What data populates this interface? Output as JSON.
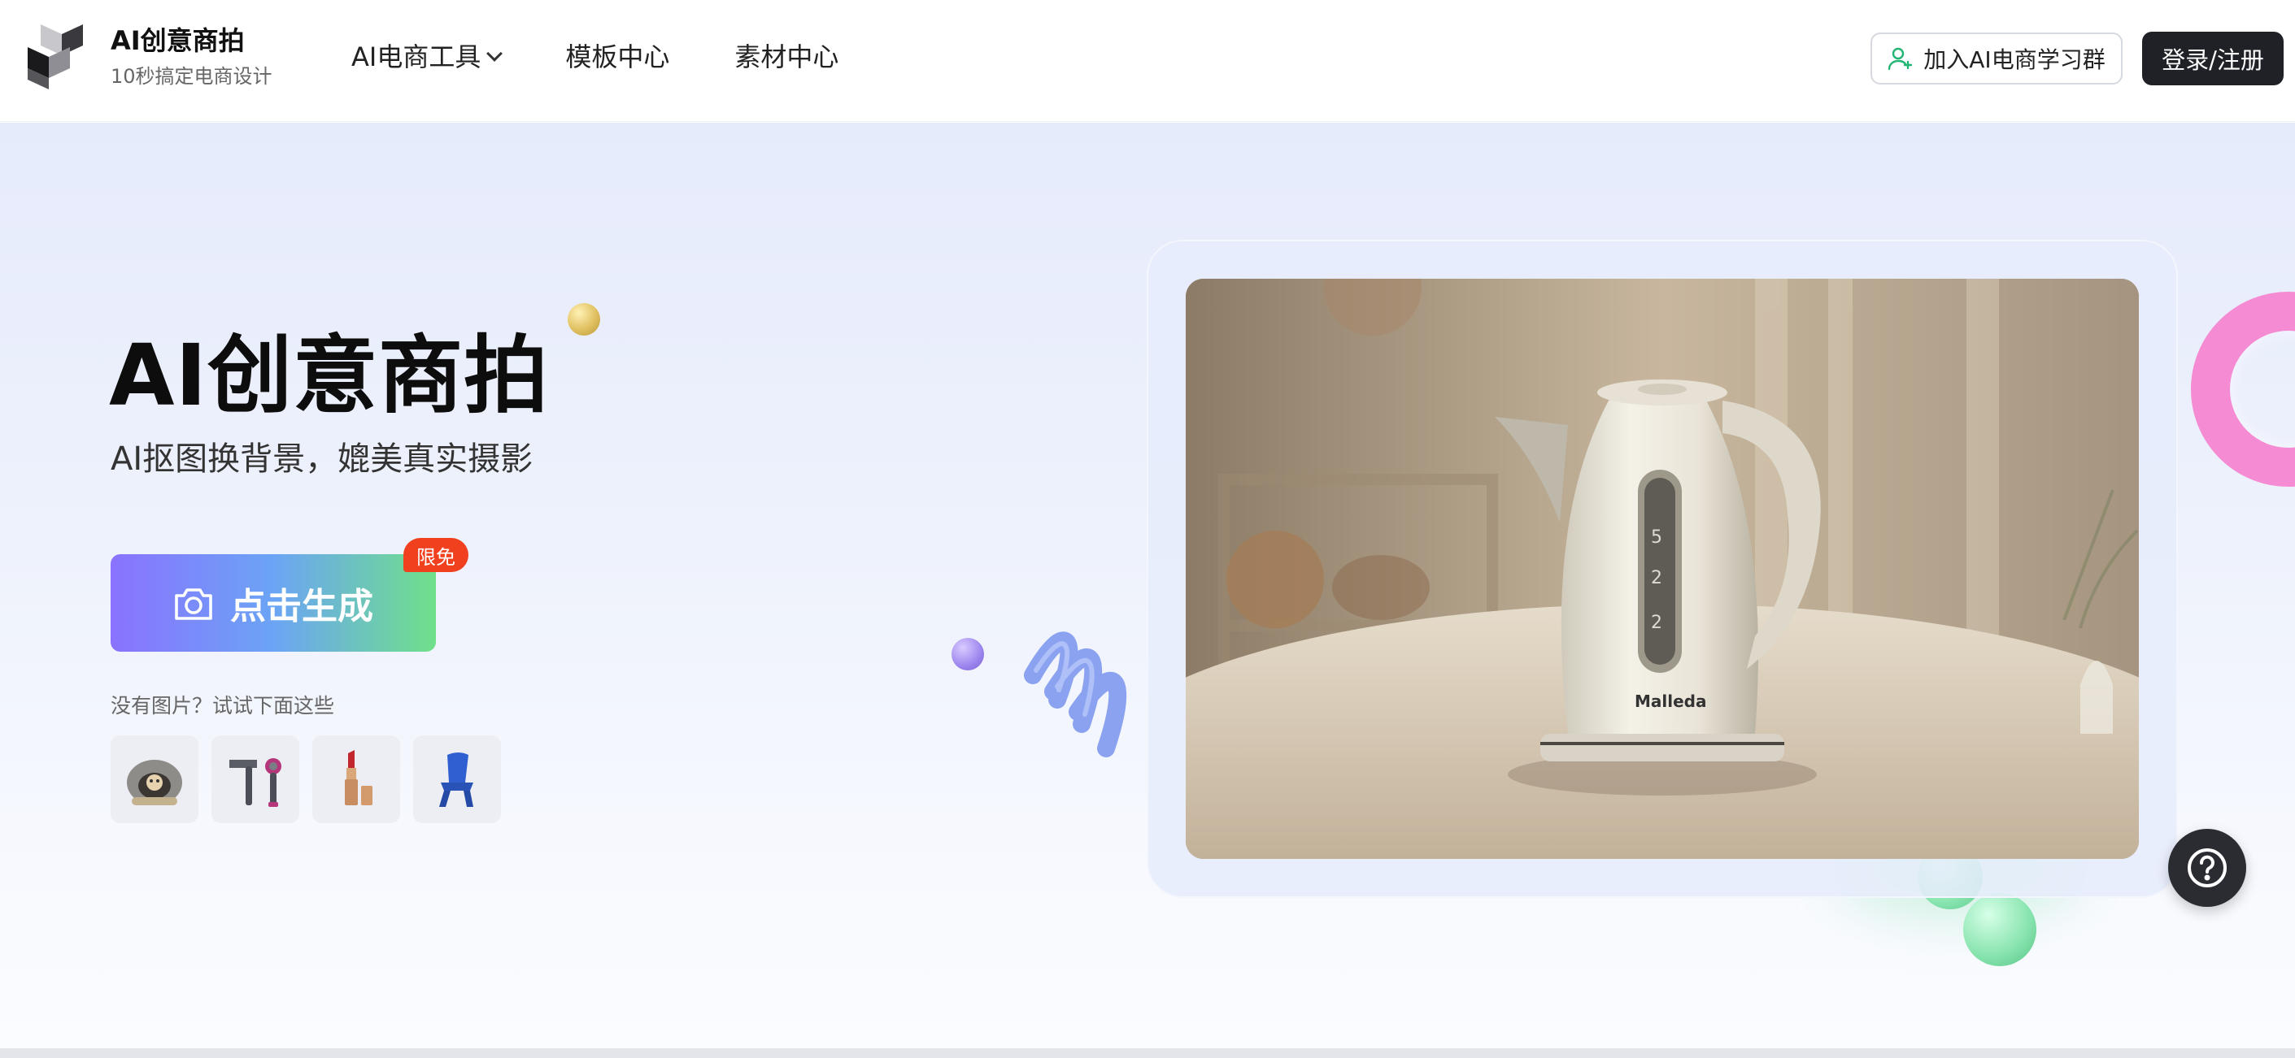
{
  "brand": {
    "title": "AI创意商拍",
    "subtitle": "10秒搞定电商设计"
  },
  "nav": {
    "items": [
      {
        "label": "AI电商工具",
        "has_dropdown": true
      },
      {
        "label": "模板中心"
      },
      {
        "label": "素材中心"
      }
    ]
  },
  "header": {
    "join_label": "加入AI电商学习群",
    "login_label": "登录/注册"
  },
  "hero": {
    "title": "AI创意商拍",
    "subtitle": "AI抠图换背景，媲美真实摄影",
    "generate_label": "点击生成",
    "badge": "限免",
    "try_label": "没有图片？试试下面这些",
    "samples": [
      {
        "name": "cat-bed",
        "icon": "cat-bed-icon"
      },
      {
        "name": "hair-dryer",
        "icon": "hair-dryer-icon"
      },
      {
        "name": "lipstick",
        "icon": "lipstick-icon"
      },
      {
        "name": "blue-chair",
        "icon": "chair-icon"
      }
    ]
  },
  "preview": {
    "brand_text": "Malleda"
  },
  "colors": {
    "accent_dark": "#1f2126",
    "badge_red": "#f0401e",
    "gradient_start": "#8a72ff",
    "gradient_end": "#6fe08a"
  },
  "icons": {
    "help": "question-icon",
    "camera": "camera-icon",
    "join": "user-plus-icon"
  }
}
